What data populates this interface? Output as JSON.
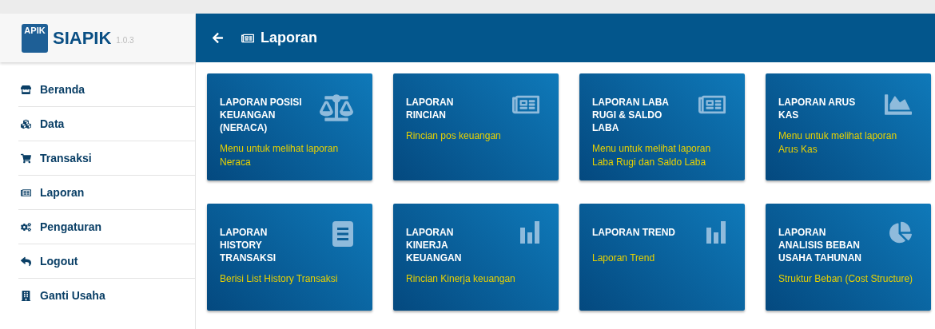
{
  "brand": {
    "logo_text": "APIK",
    "name": "SIAPIK",
    "version": "1.0.3"
  },
  "header": {
    "title": "Laporan"
  },
  "sidebar": {
    "items": [
      {
        "label": "Beranda",
        "kind": "store"
      },
      {
        "label": "Data",
        "kind": "cubes"
      },
      {
        "label": "Transaksi",
        "kind": "cart"
      },
      {
        "label": "Laporan",
        "kind": "news"
      },
      {
        "label": "Pengaturan",
        "kind": "cogs"
      },
      {
        "label": "Logout",
        "kind": "reply"
      },
      {
        "label": "Ganti Usaha",
        "kind": "building"
      }
    ]
  },
  "cards": [
    {
      "title": "LAPORAN POSISI KEUANGAN (NERACA)",
      "description": "Menu untuk melihat laporan Neraca",
      "kind": "scale"
    },
    {
      "title": "LAPORAN RINCIAN",
      "description": "Rincian pos keuangan",
      "kind": "news"
    },
    {
      "title": "LAPORAN LABA RUGI & SALDO LABA",
      "description": "Menu untuk melihat laporan Laba Rugi dan Saldo Laba",
      "kind": "news"
    },
    {
      "title": "LAPORAN ARUS KAS",
      "description": "Menu untuk melihat laporan Arus Kas",
      "kind": "area"
    },
    {
      "title": "LAPORAN HISTORY TRANSAKSI",
      "description": "Berisi List History Transaksi",
      "kind": "list"
    },
    {
      "title": "LAPORAN KINERJA KEUANGAN",
      "description": "Rincian Kinerja keuangan",
      "kind": "bars"
    },
    {
      "title": "LAPORAN TREND",
      "description": "Laporan Trend",
      "kind": "bars"
    },
    {
      "title": "LAPORAN ANALISIS BEBAN USAHA TAHUNAN",
      "description": "Struktur Beban (Cost Structure)",
      "kind": "pie"
    }
  ]
}
